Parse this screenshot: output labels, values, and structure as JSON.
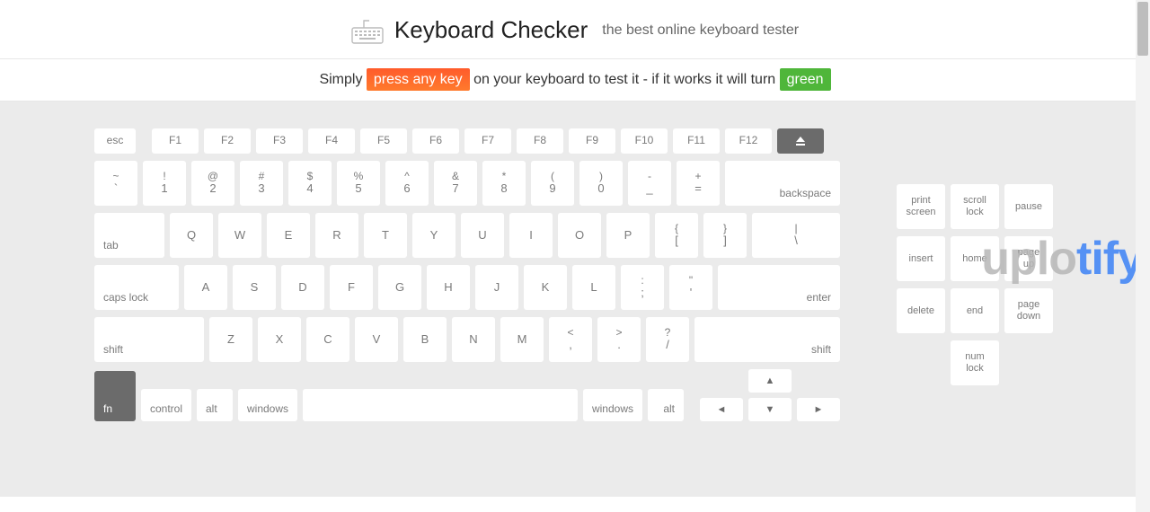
{
  "header": {
    "title": "Keyboard Checker",
    "subtitle": "the best online keyboard tester"
  },
  "instruction": {
    "pre": "Simply ",
    "badge1": "press any key",
    "mid": " on your keyboard to test it - if it works it will turn ",
    "badge2": "green"
  },
  "fn_row": [
    "esc",
    "F1",
    "F2",
    "F3",
    "F4",
    "F5",
    "F6",
    "F7",
    "F8",
    "F9",
    "F10",
    "F11",
    "F12"
  ],
  "num_row": [
    {
      "t": "~",
      "b": "`"
    },
    {
      "t": "!",
      "b": "1"
    },
    {
      "t": "@",
      "b": "2"
    },
    {
      "t": "#",
      "b": "3"
    },
    {
      "t": "$",
      "b": "4"
    },
    {
      "t": "%",
      "b": "5"
    },
    {
      "t": "^",
      "b": "6"
    },
    {
      "t": "&",
      "b": "7"
    },
    {
      "t": "*",
      "b": "8"
    },
    {
      "t": "(",
      "b": "9"
    },
    {
      "t": ")",
      "b": "0"
    },
    {
      "t": "-",
      "b": "_"
    },
    {
      "t": "+",
      "b": "="
    }
  ],
  "labels": {
    "backspace": "backspace",
    "tab": "tab",
    "caps": "caps lock",
    "enter": "enter",
    "lshift": "shift",
    "rshift": "shift",
    "fn": "fn",
    "lctrl": "control",
    "lalt": "alt",
    "lwin": "windows",
    "rwin": "windows",
    "ralt": "alt"
  },
  "q_row": [
    "Q",
    "W",
    "E",
    "R",
    "T",
    "Y",
    "U",
    "I",
    "O",
    "P"
  ],
  "q_tail": [
    {
      "t": "{",
      "b": "["
    },
    {
      "t": "}",
      "b": "]"
    },
    {
      "t": "|",
      "b": "\\"
    }
  ],
  "a_row": [
    "A",
    "S",
    "D",
    "F",
    "G",
    "H",
    "J",
    "K",
    "L"
  ],
  "a_tail": [
    {
      "t": ":",
      "b": ";"
    },
    {
      "t": "\"",
      "b": "'"
    }
  ],
  "z_row": [
    "Z",
    "X",
    "C",
    "V",
    "B",
    "N",
    "M"
  ],
  "z_tail": [
    {
      "t": "<",
      "b": ","
    },
    {
      "t": ">",
      "b": "."
    },
    {
      "t": "?",
      "b": "/"
    }
  ],
  "side": {
    "r1": [
      "print\nscreen",
      "scroll\nlock",
      "pause"
    ],
    "r2": [
      "insert",
      "home",
      "page\nup"
    ],
    "r3": [
      "delete",
      "end",
      "page\ndown"
    ],
    "numlock": "num\nlock"
  },
  "arrows": {
    "up": "▲",
    "left": "◄",
    "down": "▼",
    "right": "►"
  },
  "watermark": {
    "part1": "uplo",
    "part2": "tify"
  }
}
